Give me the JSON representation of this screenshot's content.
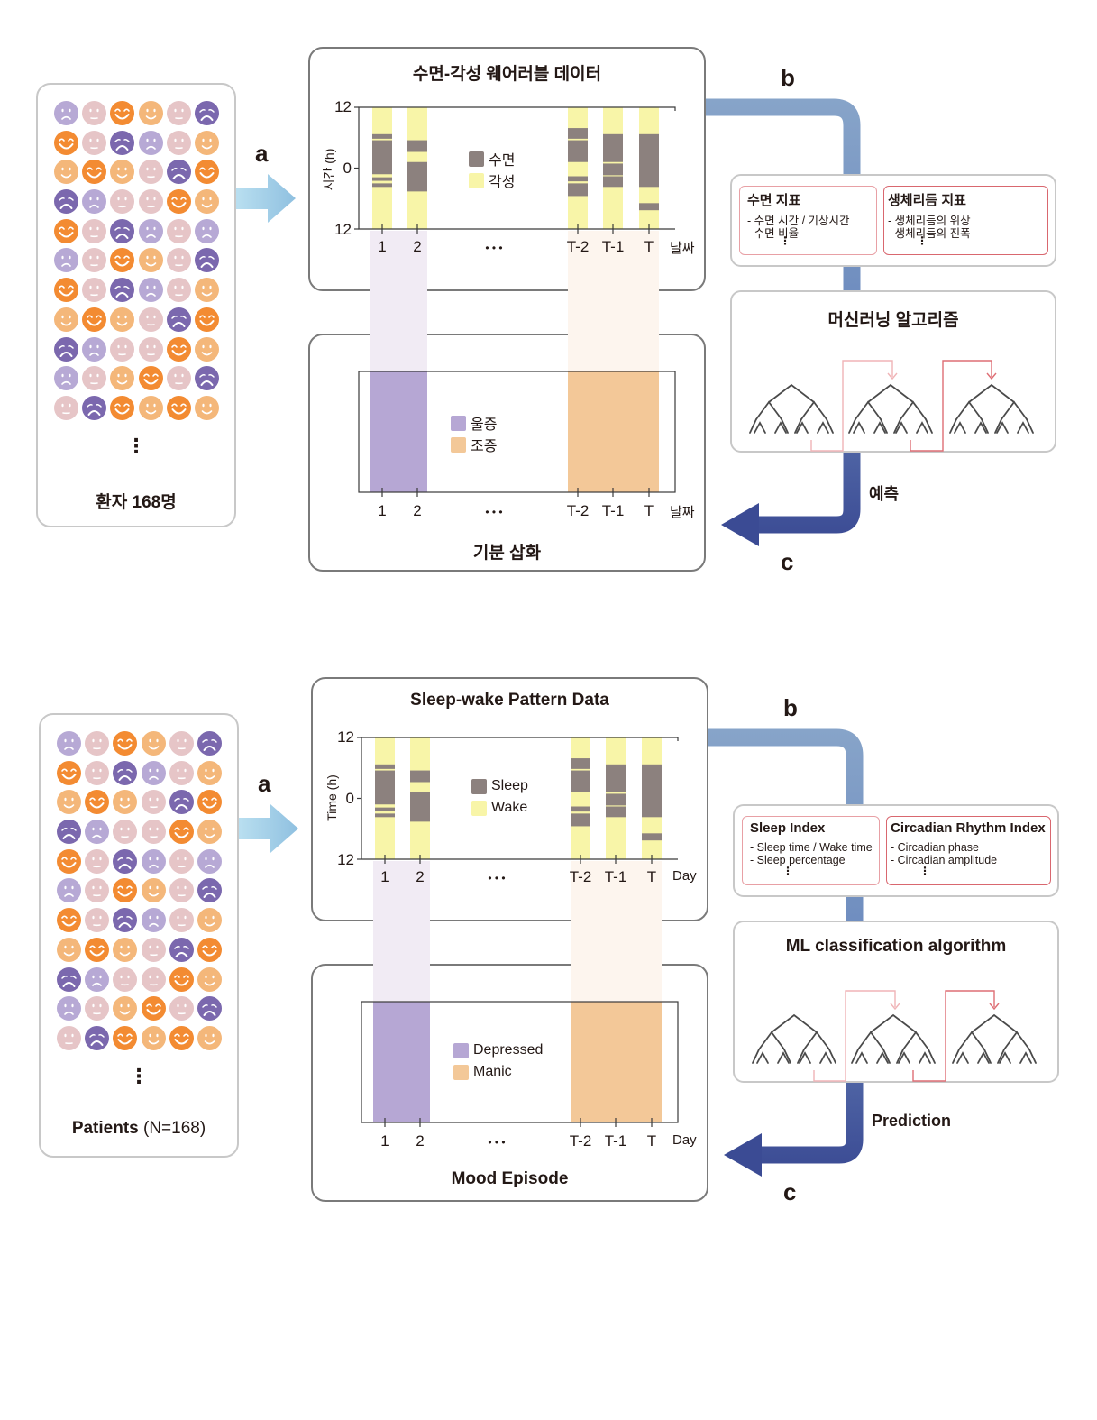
{
  "colors": {
    "sleep": "#8c817e",
    "wake": "#f8f5a8",
    "depressed": "#b6a7d4",
    "manic": "#f3c898",
    "depressed_band": "#f1ebf4",
    "manic_band": "#fdf5ee",
    "arrow_a": "#a9d4ea",
    "pipe_top": "#87a4c9",
    "pipe_bottom": "#3b4b94",
    "feature_border_light": "#e8a0a5",
    "feature_border_dark": "#d9676f",
    "face_light_purple": "#b7a9d5",
    "face_dark_purple": "#7b68ae",
    "face_pink": "#e6c5c7",
    "face_light_orange": "#f4b77a",
    "face_orange": "#f38b32"
  },
  "face_legend": {
    "L": "light-purple-sad",
    "D": "dark-purple-very-sad",
    "P": "pink-neutral",
    "S": "light-orange-smile",
    "O": "orange-big-smile"
  },
  "patient_faces": [
    [
      "L",
      "P",
      "O",
      "S",
      "P",
      "D"
    ],
    [
      "O",
      "P",
      "D",
      "L",
      "P",
      "S"
    ],
    [
      "S",
      "O",
      "S",
      "P",
      "D",
      "O"
    ],
    [
      "D",
      "L",
      "P",
      "P",
      "O",
      "S"
    ],
    [
      "O",
      "P",
      "D",
      "L",
      "P",
      "L"
    ],
    [
      "L",
      "P",
      "O",
      "S",
      "P",
      "D"
    ],
    [
      "O",
      "P",
      "D",
      "L",
      "P",
      "S"
    ],
    [
      "S",
      "O",
      "S",
      "P",
      "D",
      "O"
    ],
    [
      "D",
      "L",
      "P",
      "P",
      "O",
      "S"
    ],
    [
      "L",
      "P",
      "S",
      "O",
      "P",
      "D"
    ],
    [
      "P",
      "D",
      "O",
      "S",
      "O",
      "S"
    ]
  ],
  "chart_data": [
    {
      "type": "bar",
      "title": "수면-각성 웨어러블 데이터 / Sleep-wake Pattern Data",
      "description": "Sleep (gray) segments per day over a 24h window running 12 → 0 → 12",
      "ylabel": "Time (h)",
      "ylim": [
        0,
        24
      ],
      "yticks": [
        "12",
        "0",
        "12"
      ],
      "categories": [
        "1",
        "2",
        "T-2",
        "T-1",
        "T"
      ],
      "sleep_segments_hours_from_top": {
        "1": [
          [
            5.3,
            6.2
          ],
          [
            6.5,
            13.2
          ],
          [
            13.8,
            14.5
          ],
          [
            15.0,
            15.7
          ]
        ],
        "2": [
          [
            6.5,
            8.8
          ],
          [
            10.8,
            16.6
          ]
        ],
        "T-2": [
          [
            4.1,
            6.2
          ],
          [
            6.5,
            10.8
          ],
          [
            13.6,
            14.6
          ],
          [
            15.0,
            17.5
          ]
        ],
        "T-1": [
          [
            5.3,
            10.8
          ],
          [
            11.1,
            13.4
          ],
          [
            13.6,
            15.7
          ]
        ],
        "T": [
          [
            5.3,
            15.7
          ],
          [
            18.9,
            20.3
          ]
        ]
      }
    },
    {
      "type": "bar",
      "title": "기분 삽화 / Mood Episode",
      "categories": [
        "1",
        "2",
        "T-2",
        "T-1",
        "T"
      ],
      "episodes": [
        {
          "label": "Depressed",
          "days": [
            "1",
            "2"
          ]
        },
        {
          "label": "Manic",
          "days": [
            "T-2",
            "T-1",
            "T"
          ]
        }
      ]
    }
  ],
  "panels": [
    {
      "lang": "ko",
      "patients_label_bold": "환자 168명",
      "patients_label_light": "",
      "label_a": "a",
      "label_b": "b",
      "label_c": "c",
      "wearable_title": "수면-각성 웨어러블 데이터",
      "ylabel": "시간 (h)",
      "ytick_top": "12",
      "ytick_mid": "0",
      "ytick_bottom": "12",
      "days": [
        "1",
        "2",
        "T-2",
        "T-1",
        "T"
      ],
      "ellipsis": "• • •",
      "day_axis_label": "날짜",
      "legend_sleep": "수면",
      "legend_wake": "각성",
      "legend_depressed": "울증",
      "legend_manic": "조증",
      "mood_title": "기분 삽화",
      "sleep_index_title": "수면 지표",
      "sleep_index_items": [
        "- 수면 시간 / 기상시간",
        "- 수면 비율"
      ],
      "circadian_title": "생체리듬 지표",
      "circadian_items": [
        "- 생체리듬의 위상",
        "- 생체리듬의 진폭"
      ],
      "ml_title": "머신러닝 알고리즘",
      "prediction": "예측",
      "vdots": "⋮"
    },
    {
      "lang": "en",
      "patients_label_bold": "Patients",
      "patients_label_light": " (N=168)",
      "label_a": "a",
      "label_b": "b",
      "label_c": "c",
      "wearable_title": "Sleep-wake Pattern Data",
      "ylabel": "Time (h)",
      "ytick_top": "12",
      "ytick_mid": "0",
      "ytick_bottom": "12",
      "days": [
        "1",
        "2",
        "T-2",
        "T-1",
        "T"
      ],
      "ellipsis": "• • •",
      "day_axis_label": "Day",
      "legend_sleep": "Sleep",
      "legend_wake": "Wake",
      "legend_depressed": "Depressed",
      "legend_manic": "Manic",
      "mood_title": "Mood Episode",
      "sleep_index_title": "Sleep Index",
      "sleep_index_items": [
        "- Sleep time / Wake time",
        "- Sleep percentage"
      ],
      "circadian_title": "Circadian Rhythm Index",
      "circadian_items": [
        "- Circadian phase",
        "- Circadian amplitude"
      ],
      "ml_title": "ML classification algorithm",
      "prediction": "Prediction",
      "vdots": "⋮"
    }
  ]
}
